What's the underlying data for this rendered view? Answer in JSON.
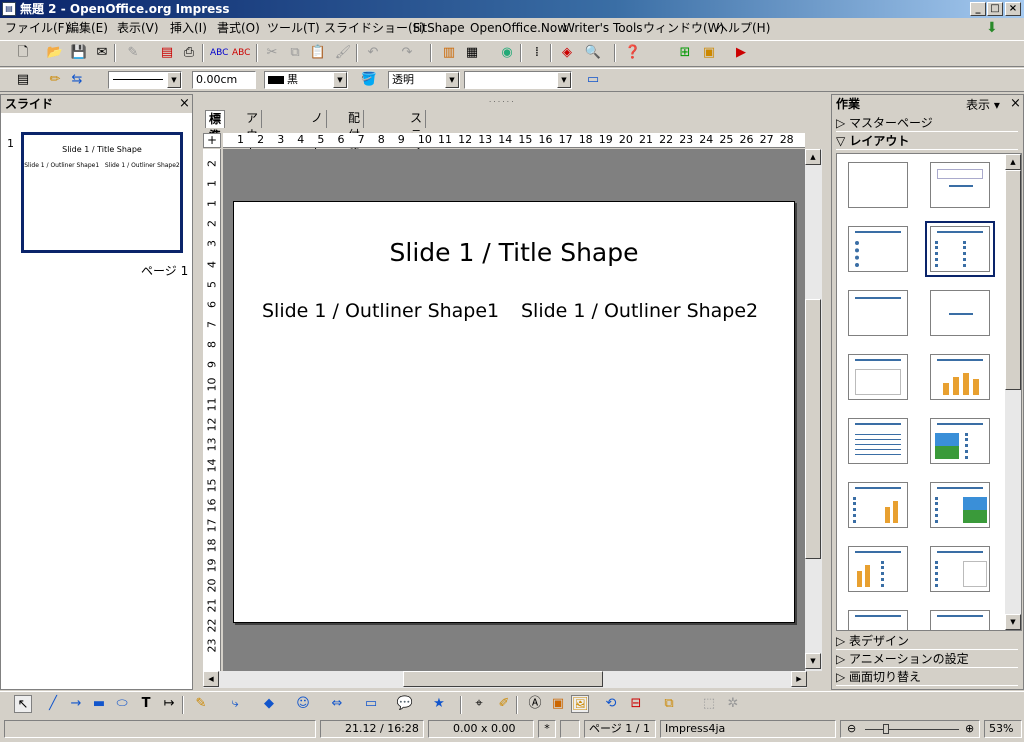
{
  "window": {
    "title": "無題 2 - OpenOffice.org Impress",
    "app_icon": "impress-icon"
  },
  "menu": [
    "ファイル(F)",
    "編集(E)",
    "表示(V)",
    "挿入(I)",
    "書式(O)",
    "ツール(T)",
    "スライドショー(S)",
    "FitShape",
    "OpenOffice.Now",
    "Writer's Tools",
    "ウィンドウ(W)",
    "ヘルプ(H)"
  ],
  "line_toolbar": {
    "line_width": "0.00cm",
    "line_color": "黒",
    "area_style": "透明",
    "area_fill": ""
  },
  "slides_pane": {
    "title": "スライド",
    "slide_number": "1",
    "thumb_title": "Slide 1 / Title Shape",
    "thumb_body": "Slide 1 / Outliner Shape1   Slide 1 / Outliner Shape2",
    "page_label": "ページ 1"
  },
  "view_tabs": [
    "標準",
    "アウトライン",
    "ノート",
    "配付資料",
    "スライド一覧"
  ],
  "slide": {
    "title": "Slide 1 / Title Shape",
    "outline1": "Slide 1 / Outliner Shape1",
    "outline2": "Slide 1 / Outliner Shape2"
  },
  "hruler_ticks": [
    "1",
    "2",
    "3",
    "4",
    "5",
    "6",
    "7",
    "8",
    "9",
    "10",
    "11",
    "12",
    "13",
    "14",
    "15",
    "16",
    "17",
    "18",
    "19",
    "20",
    "21",
    "22",
    "23",
    "24",
    "25",
    "26",
    "27",
    "28"
  ],
  "vruler_ticks": [
    "2",
    "1",
    "1",
    "2",
    "3",
    "4",
    "5",
    "6",
    "7",
    "8",
    "9",
    "10",
    "11",
    "12",
    "13",
    "14",
    "15",
    "16",
    "17",
    "18",
    "19",
    "20",
    "21",
    "22",
    "23"
  ],
  "tasks": {
    "title": "作業",
    "view_label": "表示",
    "master_pages": "マスターページ",
    "layouts": "レイアウト",
    "table_design": "表デザイン",
    "custom_animation": "アニメーションの設定",
    "transition": "画面切り替え"
  },
  "status": {
    "position": "21.12 / 16:28",
    "size": "0.00 x 0.00",
    "modified": "*",
    "page": "ページ 1 / 1",
    "master": "Impress4ja",
    "zoom": "53%"
  },
  "colors": {
    "titlebar": "#0a246a",
    "selection": "#0a246a",
    "canvas": "#808080",
    "chrome": "#d4d0c8"
  }
}
